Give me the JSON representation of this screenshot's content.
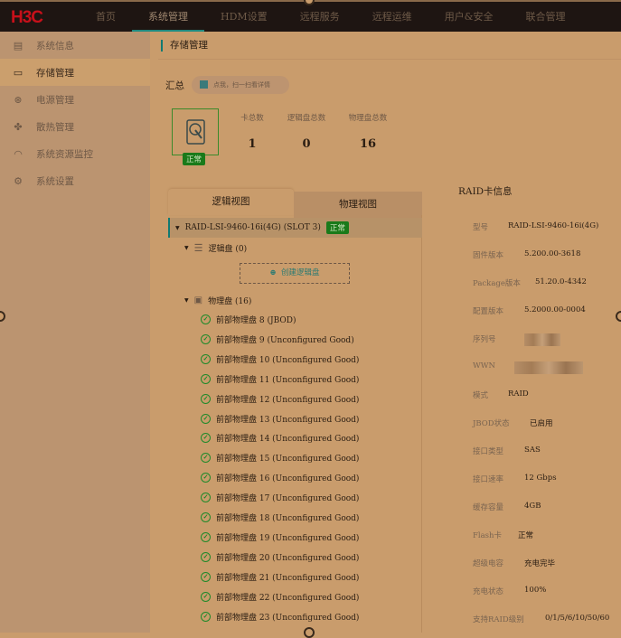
{
  "brand": "H3C",
  "nav": [
    "首页",
    "系统管理",
    "HDM设置",
    "远程服务",
    "远程运维",
    "用户&安全",
    "联合管理"
  ],
  "sidebar": [
    {
      "label": "系统信息",
      "icon": "document-icon"
    },
    {
      "label": "存储管理",
      "icon": "disk-icon"
    },
    {
      "label": "电源管理",
      "icon": "power-icon"
    },
    {
      "label": "散热管理",
      "icon": "fan-icon"
    },
    {
      "label": "系统资源监控",
      "icon": "gauge-icon"
    },
    {
      "label": "系统设置",
      "icon": "gear-icon"
    }
  ],
  "page_title": "存储管理",
  "summary": {
    "label": "汇总",
    "qr_hint": "点我，扫一扫看详情",
    "status": "正常",
    "stats": [
      {
        "label": "卡总数",
        "value": "1"
      },
      {
        "label": "逻辑盘总数",
        "value": "0"
      },
      {
        "label": "物理盘总数",
        "value": "16"
      }
    ]
  },
  "tabs": [
    "逻辑视图",
    "物理视图"
  ],
  "tree": {
    "controller": "RAID-LSI-9460-16i(4G) (SLOT 3)",
    "controller_status": "正常",
    "logical": "逻辑盘 (0)",
    "create": "创建逻辑盘",
    "physical": "物理盘 (16)",
    "disks": [
      "前部物理盘 8 (JBOD)",
      "前部物理盘 9 (Unconfigured Good)",
      "前部物理盘 10 (Unconfigured Good)",
      "前部物理盘 11 (Unconfigured Good)",
      "前部物理盘 12 (Unconfigured Good)",
      "前部物理盘 13 (Unconfigured Good)",
      "前部物理盘 14 (Unconfigured Good)",
      "前部物理盘 15 (Unconfigured Good)",
      "前部物理盘 16 (Unconfigured Good)",
      "前部物理盘 17 (Unconfigured Good)",
      "前部物理盘 18 (Unconfigured Good)",
      "前部物理盘 19 (Unconfigured Good)",
      "前部物理盘 20 (Unconfigured Good)",
      "前部物理盘 21 (Unconfigured Good)",
      "前部物理盘 22 (Unconfigured Good)",
      "前部物理盘 23 (Unconfigured Good)"
    ]
  },
  "raid_info": {
    "title": "RAID卡信息",
    "rows": [
      {
        "k": "型号",
        "v": "RAID-LSI-9460-16i(4G)"
      },
      {
        "k": "固件版本",
        "v": "5.200.00-3618"
      },
      {
        "k": "Package版本",
        "v": "51.20.0-4342"
      },
      {
        "k": "配置版本",
        "v": "5.2000.00-0004"
      },
      {
        "k": "序列号",
        "v": ""
      },
      {
        "k": "WWN",
        "v": ""
      },
      {
        "k": "模式",
        "v": "RAID"
      },
      {
        "k": "JBOD状态",
        "v": "已启用"
      },
      {
        "k": "接口类型",
        "v": "SAS"
      },
      {
        "k": "接口速率",
        "v": "12 Gbps"
      },
      {
        "k": "缓存容量",
        "v": "4GB"
      },
      {
        "k": "Flash卡",
        "v": "正常"
      },
      {
        "k": "超级电容",
        "v": "充电完毕"
      },
      {
        "k": "充电状态",
        "v": "100%"
      },
      {
        "k": "支持RAID级别",
        "v": "0/1/5/6/10/50/60"
      }
    ]
  }
}
